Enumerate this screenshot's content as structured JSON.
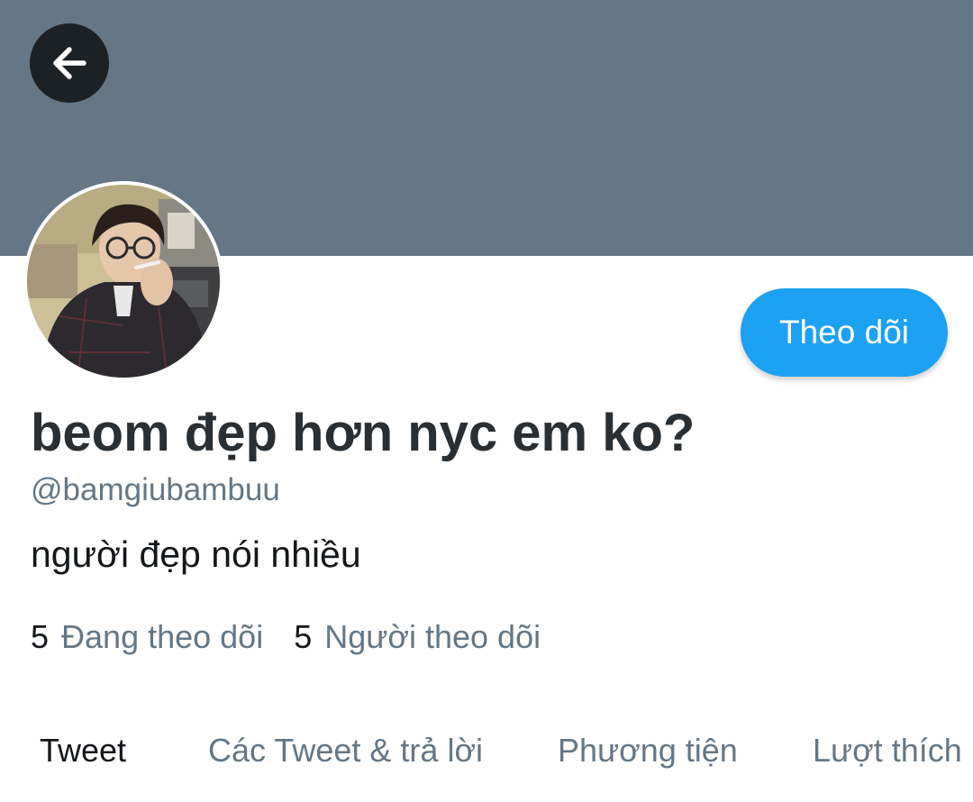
{
  "header": {
    "back_icon": "arrow-left-icon",
    "banner_color": "#657786"
  },
  "profile": {
    "display_name": "beom đẹp hơn nyc em ko?",
    "handle": "@bamgiubambuu",
    "bio": "người đẹp nói nhiều",
    "follow_label": "Theo dõi",
    "following_count": "5",
    "following_label": "Đang theo dõi",
    "followers_count": "5",
    "followers_label": "Người theo dõi"
  },
  "tabs": [
    {
      "label": "Tweet",
      "active": true
    },
    {
      "label": "Các Tweet & trả lời",
      "active": false
    },
    {
      "label": "Phương tiện",
      "active": false
    },
    {
      "label": "Lượt thích",
      "active": false
    }
  ],
  "colors": {
    "accent": "#1da1f2",
    "secondary_text": "#657786",
    "primary_text": "#14171a"
  }
}
